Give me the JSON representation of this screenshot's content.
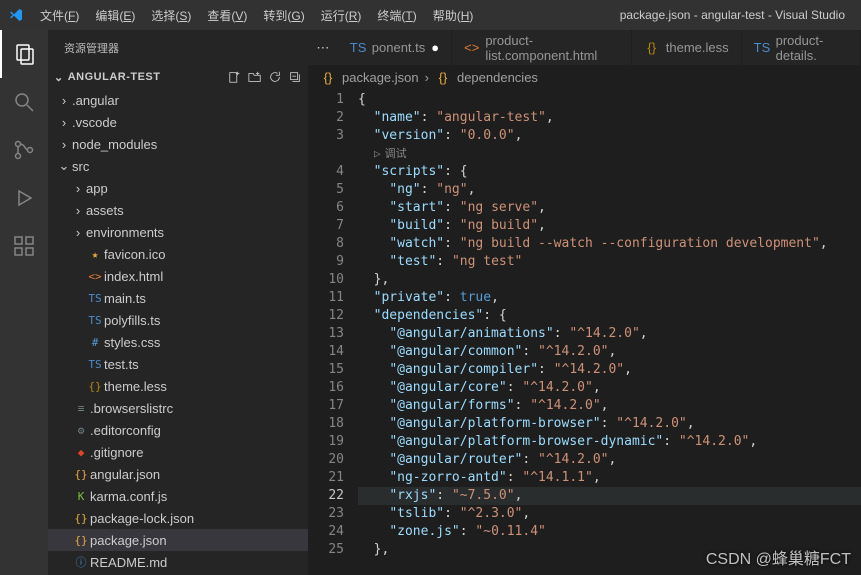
{
  "menu": [
    "文件(F)",
    "编辑(E)",
    "选择(S)",
    "查看(V)",
    "转到(G)",
    "运行(R)",
    "终端(T)",
    "帮助(H)"
  ],
  "windowTitle": "package.json - angular-test - Visual Studio",
  "explorer": {
    "title": "资源管理器",
    "rootName": "ANGULAR-TEST"
  },
  "tree": [
    {
      "d": 1,
      "t": "folder",
      "open": false,
      "label": ".angular"
    },
    {
      "d": 1,
      "t": "folder",
      "open": false,
      "label": ".vscode"
    },
    {
      "d": 1,
      "t": "folder",
      "open": false,
      "label": "node_modules"
    },
    {
      "d": 1,
      "t": "folder",
      "open": true,
      "label": "src"
    },
    {
      "d": 2,
      "t": "folder",
      "open": false,
      "label": "app"
    },
    {
      "d": 2,
      "t": "folder",
      "open": false,
      "label": "assets"
    },
    {
      "d": 2,
      "t": "folder",
      "open": false,
      "label": "environments"
    },
    {
      "d": 2,
      "t": "file",
      "icon": "★",
      "color": "#e8ab3f",
      "label": "favicon.ico"
    },
    {
      "d": 2,
      "t": "file",
      "icon": "<>",
      "color": "#e37933",
      "label": "index.html"
    },
    {
      "d": 2,
      "t": "file",
      "icon": "TS",
      "color": "#4a8bcb",
      "label": "main.ts"
    },
    {
      "d": 2,
      "t": "file",
      "icon": "TS",
      "color": "#4a8bcb",
      "label": "polyfills.ts"
    },
    {
      "d": 2,
      "t": "file",
      "icon": "#",
      "color": "#529bd4",
      "label": "styles.css"
    },
    {
      "d": 2,
      "t": "file",
      "icon": "TS",
      "color": "#4a8bcb",
      "label": "test.ts"
    },
    {
      "d": 2,
      "t": "file",
      "icon": "{}",
      "color": "#b8860b",
      "label": "theme.less"
    },
    {
      "d": 1,
      "t": "file",
      "icon": "≡",
      "color": "#6d8086",
      "label": ".browserslistrc"
    },
    {
      "d": 1,
      "t": "file",
      "icon": "⚙",
      "color": "#6d8086",
      "label": ".editorconfig"
    },
    {
      "d": 1,
      "t": "file",
      "icon": "◆",
      "color": "#e24329",
      "label": ".gitignore"
    },
    {
      "d": 1,
      "t": "file",
      "icon": "{}",
      "color": "#e8ab3f",
      "label": "angular.json"
    },
    {
      "d": 1,
      "t": "file",
      "icon": "K",
      "color": "#7fbc41",
      "label": "karma.conf.js"
    },
    {
      "d": 1,
      "t": "file",
      "icon": "{}",
      "color": "#e8ab3f",
      "label": "package-lock.json"
    },
    {
      "d": 1,
      "t": "file",
      "icon": "{}",
      "color": "#e8ab3f",
      "label": "package.json",
      "selected": true
    },
    {
      "d": 1,
      "t": "file",
      "icon": "ⓘ",
      "color": "#4a8bcb",
      "label": "README.md"
    }
  ],
  "tabs": [
    {
      "icon": "TS",
      "color": "#4a8bcb",
      "label": "ponent.ts",
      "mod": true
    },
    {
      "icon": "<>",
      "color": "#e37933",
      "label": "product-list.component.html"
    },
    {
      "icon": "{}",
      "color": "#b8860b",
      "label": "theme.less"
    },
    {
      "icon": "TS",
      "color": "#4a8bcb",
      "label": "product-details."
    }
  ],
  "breadcrumb": {
    "bracesColor": "#e8ab3f",
    "file": "package.json",
    "node": "dependencies"
  },
  "debugLens": "调试",
  "code": [
    [
      {
        "c": "p",
        "t": "{"
      }
    ],
    [
      {
        "c": "p",
        "t": "  "
      },
      {
        "c": "k",
        "t": "\"name\""
      },
      {
        "c": "p",
        "t": ": "
      },
      {
        "c": "s",
        "t": "\"angular-test\""
      },
      {
        "c": "p",
        "t": ","
      }
    ],
    [
      {
        "c": "p",
        "t": "  "
      },
      {
        "c": "k",
        "t": "\"version\""
      },
      {
        "c": "p",
        "t": ": "
      },
      {
        "c": "s",
        "t": "\"0.0.0\""
      },
      {
        "c": "p",
        "t": ","
      }
    ],
    "__DEBUG__",
    [
      {
        "c": "p",
        "t": "  "
      },
      {
        "c": "k",
        "t": "\"scripts\""
      },
      {
        "c": "p",
        "t": ": {"
      }
    ],
    [
      {
        "c": "p",
        "t": "    "
      },
      {
        "c": "k",
        "t": "\"ng\""
      },
      {
        "c": "p",
        "t": ": "
      },
      {
        "c": "s",
        "t": "\"ng\""
      },
      {
        "c": "p",
        "t": ","
      }
    ],
    [
      {
        "c": "p",
        "t": "    "
      },
      {
        "c": "k",
        "t": "\"start\""
      },
      {
        "c": "p",
        "t": ": "
      },
      {
        "c": "s",
        "t": "\"ng serve\""
      },
      {
        "c": "p",
        "t": ","
      }
    ],
    [
      {
        "c": "p",
        "t": "    "
      },
      {
        "c": "k",
        "t": "\"build\""
      },
      {
        "c": "p",
        "t": ": "
      },
      {
        "c": "s",
        "t": "\"ng build\""
      },
      {
        "c": "p",
        "t": ","
      }
    ],
    [
      {
        "c": "p",
        "t": "    "
      },
      {
        "c": "k",
        "t": "\"watch\""
      },
      {
        "c": "p",
        "t": ": "
      },
      {
        "c": "s",
        "t": "\"ng build --watch --configuration development\""
      },
      {
        "c": "p",
        "t": ","
      }
    ],
    [
      {
        "c": "p",
        "t": "    "
      },
      {
        "c": "k",
        "t": "\"test\""
      },
      {
        "c": "p",
        "t": ": "
      },
      {
        "c": "s",
        "t": "\"ng test\""
      }
    ],
    [
      {
        "c": "p",
        "t": "  },"
      }
    ],
    [
      {
        "c": "p",
        "t": "  "
      },
      {
        "c": "k",
        "t": "\"private\""
      },
      {
        "c": "p",
        "t": ": "
      },
      {
        "c": "kw",
        "t": "true"
      },
      {
        "c": "p",
        "t": ","
      }
    ],
    [
      {
        "c": "p",
        "t": "  "
      },
      {
        "c": "k",
        "t": "\"dependencies\""
      },
      {
        "c": "p",
        "t": ": {"
      }
    ],
    [
      {
        "c": "p",
        "t": "    "
      },
      {
        "c": "k",
        "t": "\"@angular/animations\""
      },
      {
        "c": "p",
        "t": ": "
      },
      {
        "c": "s",
        "t": "\"^14.2.0\""
      },
      {
        "c": "p",
        "t": ","
      }
    ],
    [
      {
        "c": "p",
        "t": "    "
      },
      {
        "c": "k",
        "t": "\"@angular/common\""
      },
      {
        "c": "p",
        "t": ": "
      },
      {
        "c": "s",
        "t": "\"^14.2.0\""
      },
      {
        "c": "p",
        "t": ","
      }
    ],
    [
      {
        "c": "p",
        "t": "    "
      },
      {
        "c": "k",
        "t": "\"@angular/compiler\""
      },
      {
        "c": "p",
        "t": ": "
      },
      {
        "c": "s",
        "t": "\"^14.2.0\""
      },
      {
        "c": "p",
        "t": ","
      }
    ],
    [
      {
        "c": "p",
        "t": "    "
      },
      {
        "c": "k",
        "t": "\"@angular/core\""
      },
      {
        "c": "p",
        "t": ": "
      },
      {
        "c": "s",
        "t": "\"^14.2.0\""
      },
      {
        "c": "p",
        "t": ","
      }
    ],
    [
      {
        "c": "p",
        "t": "    "
      },
      {
        "c": "k",
        "t": "\"@angular/forms\""
      },
      {
        "c": "p",
        "t": ": "
      },
      {
        "c": "s",
        "t": "\"^14.2.0\""
      },
      {
        "c": "p",
        "t": ","
      }
    ],
    [
      {
        "c": "p",
        "t": "    "
      },
      {
        "c": "k",
        "t": "\"@angular/platform-browser\""
      },
      {
        "c": "p",
        "t": ": "
      },
      {
        "c": "s",
        "t": "\"^14.2.0\""
      },
      {
        "c": "p",
        "t": ","
      }
    ],
    [
      {
        "c": "p",
        "t": "    "
      },
      {
        "c": "k",
        "t": "\"@angular/platform-browser-dynamic\""
      },
      {
        "c": "p",
        "t": ": "
      },
      {
        "c": "s",
        "t": "\"^14.2.0\""
      },
      {
        "c": "p",
        "t": ","
      }
    ],
    [
      {
        "c": "p",
        "t": "    "
      },
      {
        "c": "k",
        "t": "\"@angular/router\""
      },
      {
        "c": "p",
        "t": ": "
      },
      {
        "c": "s",
        "t": "\"^14.2.0\""
      },
      {
        "c": "p",
        "t": ","
      }
    ],
    [
      {
        "c": "p",
        "t": "    "
      },
      {
        "c": "k",
        "t": "\"ng-zorro-antd\""
      },
      {
        "c": "p",
        "t": ": "
      },
      {
        "c": "s",
        "t": "\"^14.1.1\""
      },
      {
        "c": "p",
        "t": ","
      }
    ],
    [
      {
        "c": "p",
        "t": "    "
      },
      {
        "c": "k",
        "t": "\"rxjs\""
      },
      {
        "c": "p",
        "t": ": "
      },
      {
        "c": "s",
        "t": "\"~7.5.0\""
      },
      {
        "c": "p",
        "t": ","
      }
    ],
    [
      {
        "c": "p",
        "t": "    "
      },
      {
        "c": "k",
        "t": "\"tslib\""
      },
      {
        "c": "p",
        "t": ": "
      },
      {
        "c": "s",
        "t": "\"^2.3.0\""
      },
      {
        "c": "p",
        "t": ","
      }
    ],
    [
      {
        "c": "p",
        "t": "    "
      },
      {
        "c": "k",
        "t": "\"zone.js\""
      },
      {
        "c": "p",
        "t": ": "
      },
      {
        "c": "s",
        "t": "\"~0.11.4\""
      }
    ],
    [
      {
        "c": "p",
        "t": "  },"
      }
    ]
  ],
  "currentLine": 22,
  "watermark": "CSDN @蜂巢糖FCT"
}
